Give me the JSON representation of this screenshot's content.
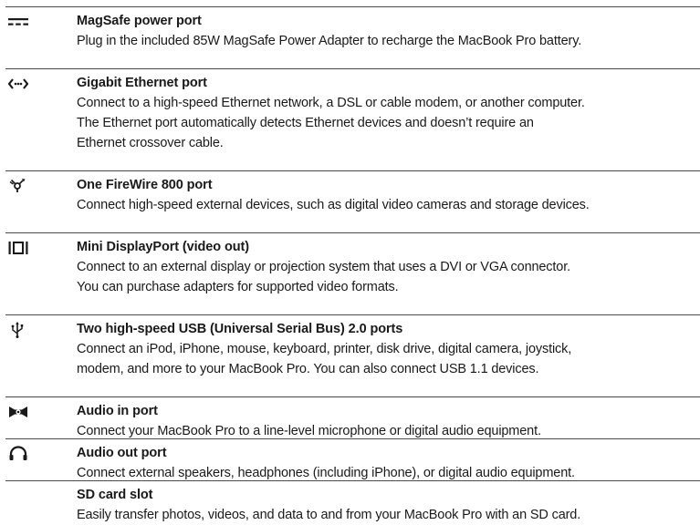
{
  "ports": [
    {
      "icon": "magsafe-power-icon",
      "title": "MagSafe power port",
      "description": "Plug in the included 85W MagSafe Power Adapter to recharge the MacBook Pro battery."
    },
    {
      "icon": "ethernet-icon",
      "title": "Gigabit Ethernet port",
      "description_lines": [
        "Connect to a high-speed Ethernet network, a DSL or cable modem, or another computer.",
        "The Ethernet port automatically detects Ethernet devices and doesn’t require an",
        "Ethernet crossover cable."
      ]
    },
    {
      "icon": "firewire-icon",
      "title": "One FireWire 800 port",
      "description": "Connect high-speed external devices, such as digital video cameras and storage devices."
    },
    {
      "icon": "mini-displayport-icon",
      "title": "Mini DisplayPort (video out)",
      "description_lines": [
        "Connect to an external display or projection system that uses a DVI or VGA connector.",
        "You can purchase adapters for supported video formats."
      ]
    },
    {
      "icon": "usb-icon",
      "title": "Two high-speed USB (Universal Serial Bus) 2.0 ports",
      "description_lines": [
        "Connect an iPod, iPhone, mouse, keyboard, printer, disk drive, digital camera, joystick,",
        "modem, and more to your MacBook Pro. You can also connect USB 1.1 devices."
      ]
    },
    {
      "icon": "audio-in-icon",
      "title": "Audio in port",
      "description": "Connect your MacBook Pro to a line-level microphone or digital audio equipment."
    },
    {
      "icon": "headphones-icon",
      "title": "Audio out port",
      "description": "Connect external speakers, headphones (including iPhone), or digital audio equipment."
    },
    {
      "icon": "",
      "title": "SD card slot",
      "description": "Easily transfer photos, videos, and data to and from your MacBook Pro with an SD card."
    }
  ]
}
